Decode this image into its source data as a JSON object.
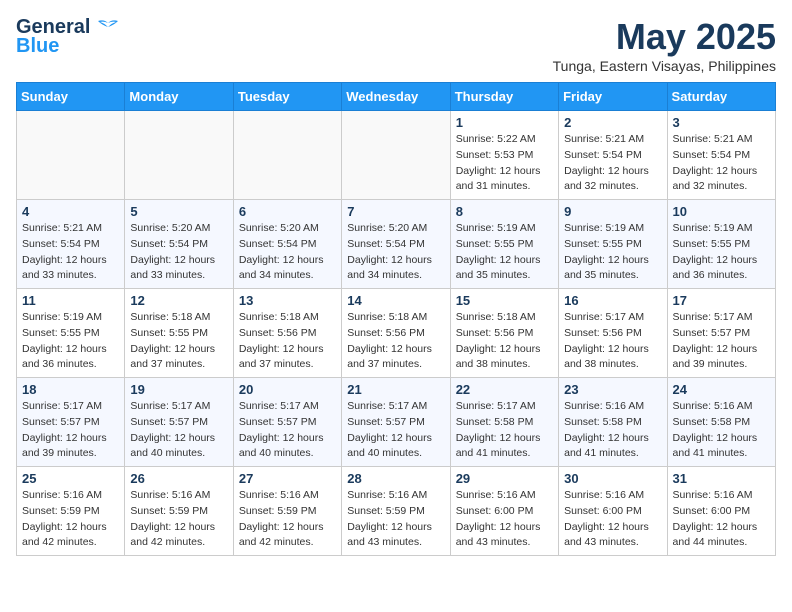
{
  "logo": {
    "text_general": "General",
    "text_blue": "Blue"
  },
  "title": {
    "month_year": "May 2025",
    "location": "Tunga, Eastern Visayas, Philippines"
  },
  "weekdays": [
    "Sunday",
    "Monday",
    "Tuesday",
    "Wednesday",
    "Thursday",
    "Friday",
    "Saturday"
  ],
  "weeks": [
    [
      {
        "day": "",
        "info": ""
      },
      {
        "day": "",
        "info": ""
      },
      {
        "day": "",
        "info": ""
      },
      {
        "day": "",
        "info": ""
      },
      {
        "day": "1",
        "info": "Sunrise: 5:22 AM\nSunset: 5:53 PM\nDaylight: 12 hours\nand 31 minutes."
      },
      {
        "day": "2",
        "info": "Sunrise: 5:21 AM\nSunset: 5:54 PM\nDaylight: 12 hours\nand 32 minutes."
      },
      {
        "day": "3",
        "info": "Sunrise: 5:21 AM\nSunset: 5:54 PM\nDaylight: 12 hours\nand 32 minutes."
      }
    ],
    [
      {
        "day": "4",
        "info": "Sunrise: 5:21 AM\nSunset: 5:54 PM\nDaylight: 12 hours\nand 33 minutes."
      },
      {
        "day": "5",
        "info": "Sunrise: 5:20 AM\nSunset: 5:54 PM\nDaylight: 12 hours\nand 33 minutes."
      },
      {
        "day": "6",
        "info": "Sunrise: 5:20 AM\nSunset: 5:54 PM\nDaylight: 12 hours\nand 34 minutes."
      },
      {
        "day": "7",
        "info": "Sunrise: 5:20 AM\nSunset: 5:54 PM\nDaylight: 12 hours\nand 34 minutes."
      },
      {
        "day": "8",
        "info": "Sunrise: 5:19 AM\nSunset: 5:55 PM\nDaylight: 12 hours\nand 35 minutes."
      },
      {
        "day": "9",
        "info": "Sunrise: 5:19 AM\nSunset: 5:55 PM\nDaylight: 12 hours\nand 35 minutes."
      },
      {
        "day": "10",
        "info": "Sunrise: 5:19 AM\nSunset: 5:55 PM\nDaylight: 12 hours\nand 36 minutes."
      }
    ],
    [
      {
        "day": "11",
        "info": "Sunrise: 5:19 AM\nSunset: 5:55 PM\nDaylight: 12 hours\nand 36 minutes."
      },
      {
        "day": "12",
        "info": "Sunrise: 5:18 AM\nSunset: 5:55 PM\nDaylight: 12 hours\nand 37 minutes."
      },
      {
        "day": "13",
        "info": "Sunrise: 5:18 AM\nSunset: 5:56 PM\nDaylight: 12 hours\nand 37 minutes."
      },
      {
        "day": "14",
        "info": "Sunrise: 5:18 AM\nSunset: 5:56 PM\nDaylight: 12 hours\nand 37 minutes."
      },
      {
        "day": "15",
        "info": "Sunrise: 5:18 AM\nSunset: 5:56 PM\nDaylight: 12 hours\nand 38 minutes."
      },
      {
        "day": "16",
        "info": "Sunrise: 5:17 AM\nSunset: 5:56 PM\nDaylight: 12 hours\nand 38 minutes."
      },
      {
        "day": "17",
        "info": "Sunrise: 5:17 AM\nSunset: 5:57 PM\nDaylight: 12 hours\nand 39 minutes."
      }
    ],
    [
      {
        "day": "18",
        "info": "Sunrise: 5:17 AM\nSunset: 5:57 PM\nDaylight: 12 hours\nand 39 minutes."
      },
      {
        "day": "19",
        "info": "Sunrise: 5:17 AM\nSunset: 5:57 PM\nDaylight: 12 hours\nand 40 minutes."
      },
      {
        "day": "20",
        "info": "Sunrise: 5:17 AM\nSunset: 5:57 PM\nDaylight: 12 hours\nand 40 minutes."
      },
      {
        "day": "21",
        "info": "Sunrise: 5:17 AM\nSunset: 5:57 PM\nDaylight: 12 hours\nand 40 minutes."
      },
      {
        "day": "22",
        "info": "Sunrise: 5:17 AM\nSunset: 5:58 PM\nDaylight: 12 hours\nand 41 minutes."
      },
      {
        "day": "23",
        "info": "Sunrise: 5:16 AM\nSunset: 5:58 PM\nDaylight: 12 hours\nand 41 minutes."
      },
      {
        "day": "24",
        "info": "Sunrise: 5:16 AM\nSunset: 5:58 PM\nDaylight: 12 hours\nand 41 minutes."
      }
    ],
    [
      {
        "day": "25",
        "info": "Sunrise: 5:16 AM\nSunset: 5:59 PM\nDaylight: 12 hours\nand 42 minutes."
      },
      {
        "day": "26",
        "info": "Sunrise: 5:16 AM\nSunset: 5:59 PM\nDaylight: 12 hours\nand 42 minutes."
      },
      {
        "day": "27",
        "info": "Sunrise: 5:16 AM\nSunset: 5:59 PM\nDaylight: 12 hours\nand 42 minutes."
      },
      {
        "day": "28",
        "info": "Sunrise: 5:16 AM\nSunset: 5:59 PM\nDaylight: 12 hours\nand 43 minutes."
      },
      {
        "day": "29",
        "info": "Sunrise: 5:16 AM\nSunset: 6:00 PM\nDaylight: 12 hours\nand 43 minutes."
      },
      {
        "day": "30",
        "info": "Sunrise: 5:16 AM\nSunset: 6:00 PM\nDaylight: 12 hours\nand 43 minutes."
      },
      {
        "day": "31",
        "info": "Sunrise: 5:16 AM\nSunset: 6:00 PM\nDaylight: 12 hours\nand 44 minutes."
      }
    ]
  ]
}
